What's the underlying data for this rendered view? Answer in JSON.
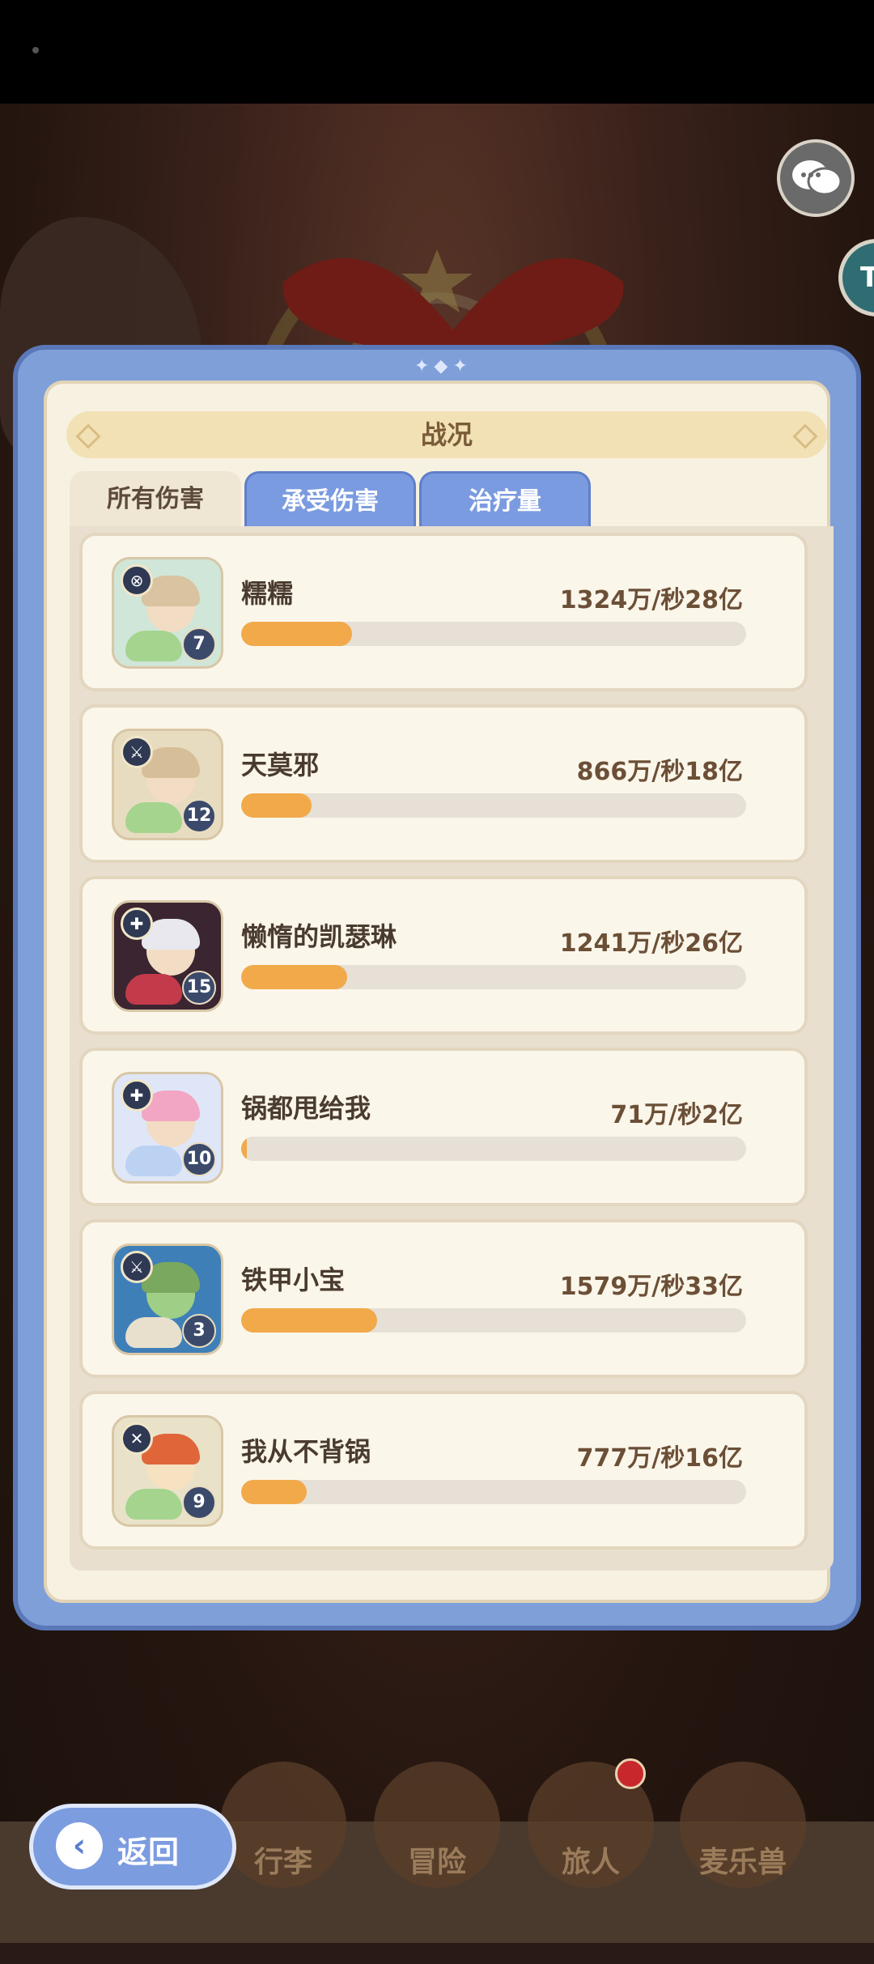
{
  "battle_panel": {
    "title": "战况",
    "tabs": [
      {
        "label": "所有伤害",
        "active": true
      },
      {
        "label": "承受伤害",
        "active": false
      },
      {
        "label": "治疗量",
        "active": false
      }
    ],
    "entries": [
      {
        "name": "糯糯",
        "stat": "1324万/秒28亿",
        "level": "7",
        "share": 0.22,
        "class_icon": "target-icon"
      },
      {
        "name": "天莫邪",
        "stat": "866万/秒18亿",
        "level": "12",
        "share": 0.14,
        "class_icon": "sword-icon"
      },
      {
        "name": "懒惰的凯瑟琳",
        "stat": "1241万/秒26亿",
        "level": "15",
        "share": 0.21,
        "class_icon": "cross-icon"
      },
      {
        "name": "锅都甩给我",
        "stat": "71万/秒2亿",
        "level": "10",
        "share": 0.012,
        "class_icon": "cross-icon"
      },
      {
        "name": "铁甲小宝",
        "stat": "1579万/秒33亿",
        "level": "3",
        "share": 0.27,
        "class_icon": "sword-icon"
      },
      {
        "name": "我从不背锅",
        "stat": "777万/秒16亿",
        "level": "9",
        "share": 0.13,
        "class_icon": "crossed-swords-icon"
      }
    ]
  },
  "bottom_nav": {
    "back_label": "返回",
    "items": [
      "行李",
      "冒险",
      "旅人",
      "麦乐兽"
    ]
  },
  "colors": {
    "panel_blue": "#7f9fd9",
    "bar_fill": "#f1a94a",
    "bar_track": "#e6e0d6"
  }
}
